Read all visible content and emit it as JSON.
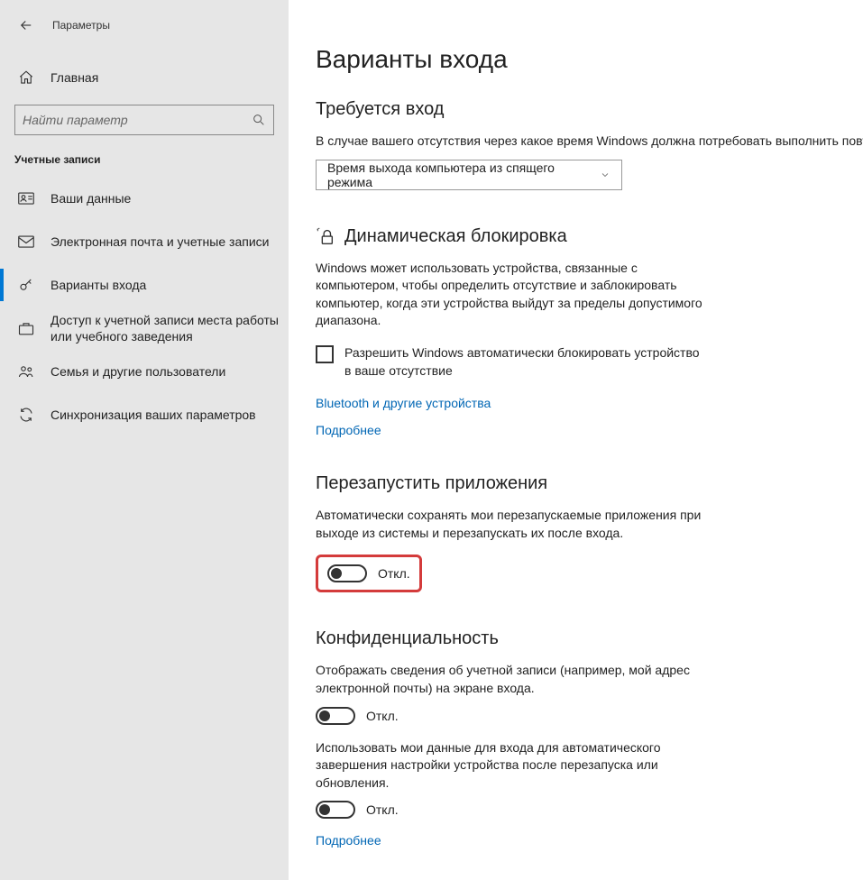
{
  "window_title": "Параметры",
  "sidebar": {
    "home": "Главная",
    "search_placeholder": "Найти параметр",
    "section": "Учетные записи",
    "items": [
      {
        "label": "Ваши данные"
      },
      {
        "label": "Электронная почта и учетные записи"
      },
      {
        "label": "Варианты входа"
      },
      {
        "label": "Доступ к учетной записи места работы или учебного заведения"
      },
      {
        "label": "Семья и другие пользователи"
      },
      {
        "label": "Синхронизация ваших параметров"
      }
    ]
  },
  "main": {
    "title": "Варианты входа",
    "signin_req": {
      "heading": "Требуется вход",
      "desc": "В случае вашего отсутствия через какое время Windows должна потребовать выполнить повто",
      "dropdown_value": "Время выхода компьютера из спящего режима"
    },
    "dynlock": {
      "heading": "Динамическая блокировка",
      "desc": "Windows может использовать устройства, связанные с компьютером, чтобы определить отсутствие и заблокировать компьютер, когда эти устройства выйдут за пределы допустимого диапазона.",
      "checkbox_label": "Разрешить Windows автоматически блокировать устройство в ваше отсутствие",
      "link1": "Bluetooth и другие устройства",
      "link2": "Подробнее"
    },
    "restart_apps": {
      "heading": "Перезапустить приложения",
      "desc": "Автоматически сохранять мои перезапускаемые приложения при выходе из системы и перезапускать их после входа.",
      "toggle_state": "Откл."
    },
    "privacy": {
      "heading": "Конфиденциальность",
      "desc1": "Отображать сведения об учетной записи (например, мой адрес электронной почты) на экране входа.",
      "toggle1_state": "Откл.",
      "desc2": "Использовать мои данные для входа для автоматического завершения настройки устройства после перезапуска или обновления.",
      "toggle2_state": "Откл.",
      "link": "Подробнее"
    }
  }
}
